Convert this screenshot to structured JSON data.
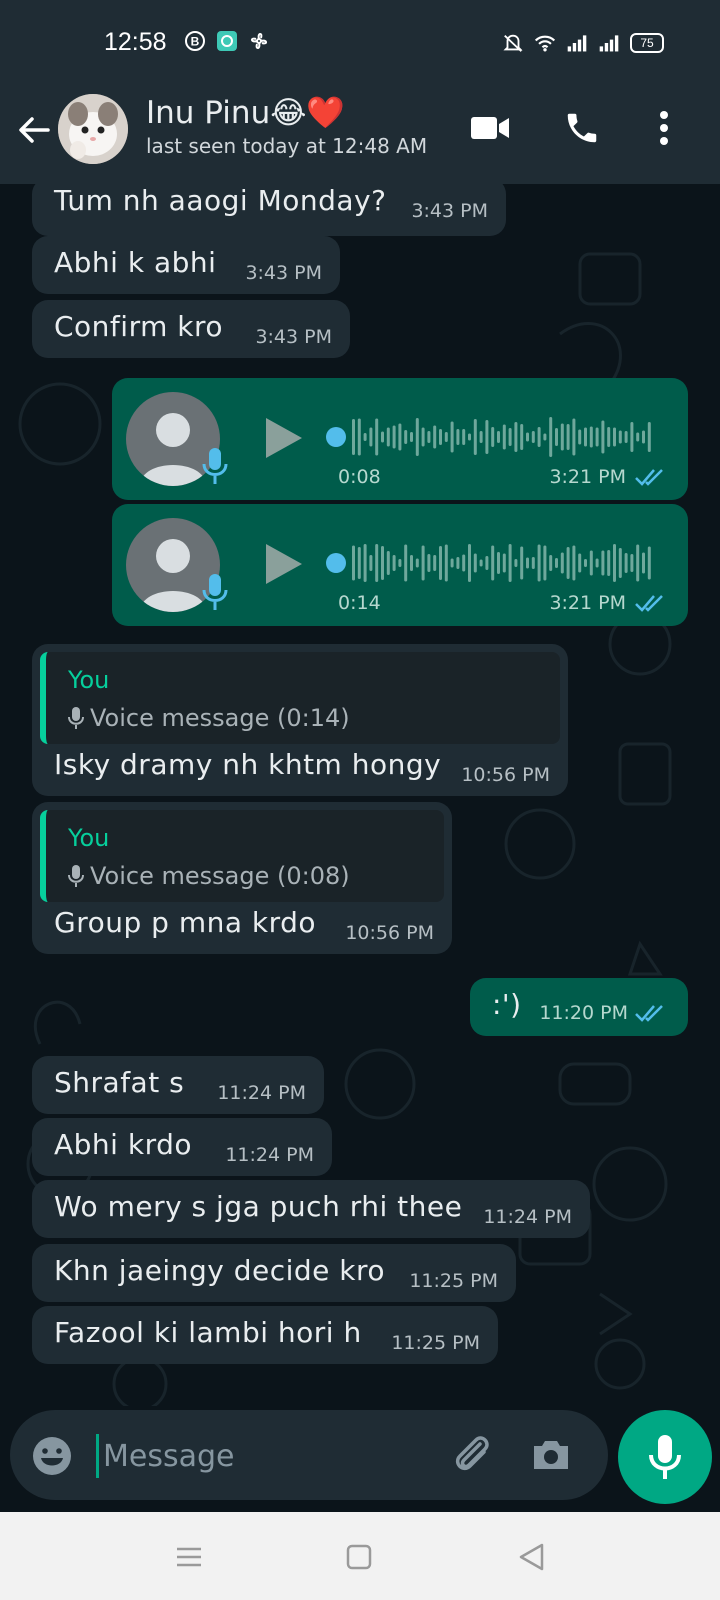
{
  "status_bar": {
    "time": "12:58",
    "battery": "75",
    "icons": [
      "b-icon",
      "app-icon",
      "fan-icon",
      "mute-icon",
      "wifi-icon",
      "signal-icon",
      "signal-icon",
      "battery-icon"
    ]
  },
  "header": {
    "contact_name": "Inu Pinu😂❤️",
    "last_seen": "last seen today at 12:48 AM"
  },
  "messages": [
    {
      "type": "in",
      "text": "Tum nh aaogi Monday?",
      "time": "3:43 PM"
    },
    {
      "type": "in",
      "text": "Abhi k abhi",
      "time": "3:43 PM"
    },
    {
      "type": "in",
      "text": "Confirm kro",
      "time": "3:43 PM"
    },
    {
      "type": "voice_out",
      "duration": "0:08",
      "time": "3:21 PM"
    },
    {
      "type": "voice_out",
      "duration": "0:14",
      "time": "3:21 PM"
    },
    {
      "type": "reply_in",
      "quote_author": "You",
      "quote_text": "Voice message (0:14)",
      "text": "Isky dramy nh khtm hongy",
      "time": "10:56 PM"
    },
    {
      "type": "reply_in",
      "quote_author": "You",
      "quote_text": "Voice message (0:08)",
      "text": "Group p mna krdo",
      "time": "10:56 PM"
    },
    {
      "type": "out",
      "text": ":')",
      "time": "11:20 PM"
    },
    {
      "type": "in",
      "text": "Shrafat s",
      "time": "11:24 PM"
    },
    {
      "type": "in",
      "text": "Abhi krdo",
      "time": "11:24 PM"
    },
    {
      "type": "in",
      "text": "Wo mery s jga puch rhi thee",
      "time": "11:24 PM"
    },
    {
      "type": "in",
      "text": "Khn jaeingy decide kro",
      "time": "11:25 PM"
    },
    {
      "type": "in",
      "text": "Fazool ki lambi hori h",
      "time": "11:25 PM"
    }
  ],
  "composer": {
    "placeholder": "Message"
  },
  "colors": {
    "header_bg": "#1f2c34",
    "chat_bg": "#0b141a",
    "incoming_bubble": "#1f2c34",
    "outgoing_bubble": "#005c4b",
    "accent": "#00a884",
    "read_ticks": "#53bdeb"
  }
}
